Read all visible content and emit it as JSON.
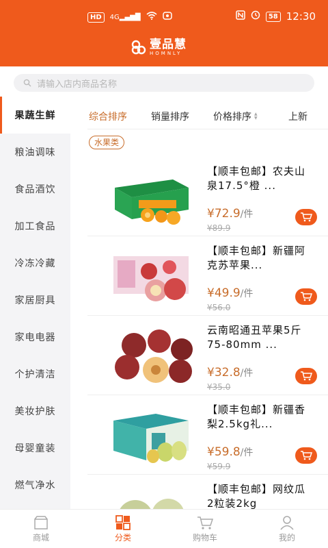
{
  "status_bar": {
    "left_badge": "HD",
    "signal_text": "4G",
    "battery": "58",
    "time": "12:30"
  },
  "brand": {
    "name_cn": "壹品慧",
    "name_en": "HOMNLY"
  },
  "search": {
    "placeholder": "请输入店内商品名称"
  },
  "sidebar": {
    "items": [
      "果蔬生鲜",
      "粮油调味",
      "食品酒饮",
      "加工食品",
      "冷冻冷藏",
      "家居厨具",
      "家电电器",
      "个护清洁",
      "美妆护肤",
      "母婴童装",
      "燃气净水"
    ]
  },
  "sort": {
    "items": [
      "综合排序",
      "销量排序",
      "价格排序",
      "上新"
    ]
  },
  "category_tag": "水果类",
  "products": [
    {
      "title": "【顺丰包邮】农夫山泉17.5°橙 ...",
      "price": "¥72.9",
      "unit": "/件",
      "old_price": "¥89.9"
    },
    {
      "title": "【顺丰包邮】新疆阿克苏苹果...",
      "price": "¥49.9",
      "unit": "/件",
      "old_price": "¥56.0"
    },
    {
      "title": "云南昭通丑苹果5斤 75-80mm ...",
      "price": "¥32.8",
      "unit": "/件",
      "old_price": "¥35.0"
    },
    {
      "title": "【顺丰包邮】新疆香梨2.5kg礼...",
      "price": "¥59.8",
      "unit": "/件",
      "old_price": "¥59.9"
    },
    {
      "title": "【顺丰包邮】网纹瓜2粒装2kg",
      "price": "",
      "unit": "",
      "old_price": ""
    }
  ],
  "tabbar": {
    "items": [
      "商城",
      "分类",
      "购物车",
      "我的"
    ]
  },
  "colors": {
    "brand": "#ef5a1c",
    "price": "#c86d2b"
  }
}
